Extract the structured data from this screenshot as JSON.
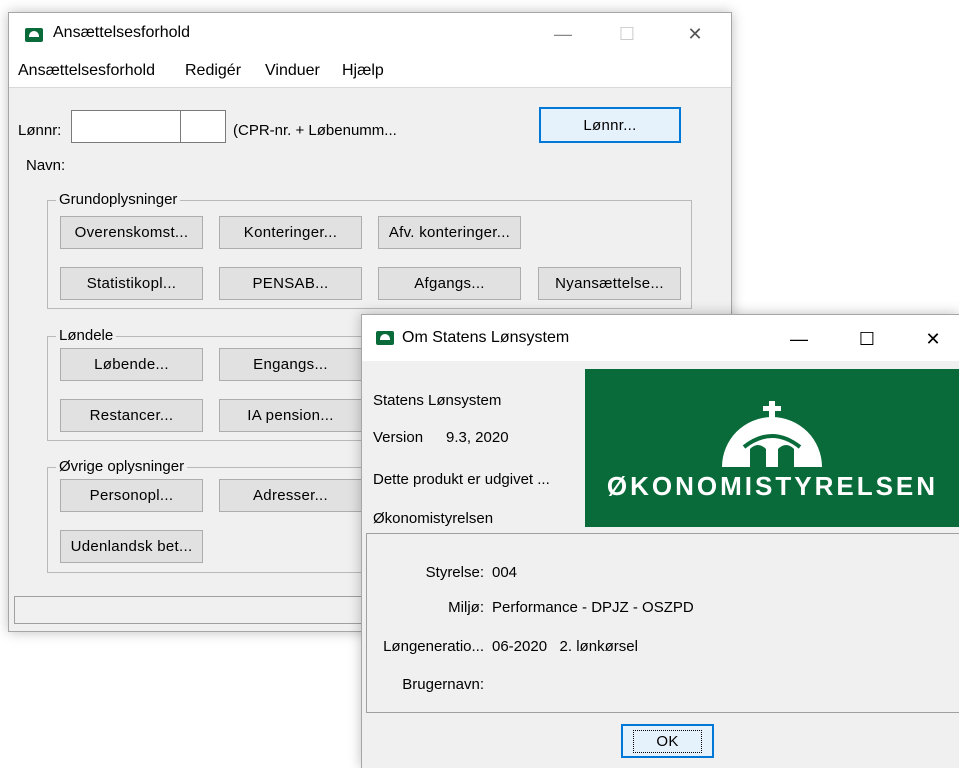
{
  "main_window": {
    "title": "Ansættelsesforhold",
    "menu": [
      "Ansættelsesforhold",
      "Redigér",
      "Vinduer",
      "Hjælp"
    ],
    "lonnr_label": "Lønnr:",
    "lonnr_hint": "(CPR-nr. + Løbenumm...",
    "lonnr_button": "Lønnr...",
    "navn_label": "Navn:",
    "groups": {
      "grundoplysninger": {
        "label": "Grundoplysninger",
        "buttons": [
          "Overenskomst...",
          "Konteringer...",
          "Afv. konteringer...",
          "Statistikopl...",
          "PENSAB...",
          "Afgangs...",
          "Nyansættelse..."
        ]
      },
      "londele": {
        "label": "Løndele",
        "buttons": [
          "Løbende...",
          "Engangs...",
          "Restancer...",
          "IA pension..."
        ]
      },
      "ovrige": {
        "label": "Øvrige oplysninger",
        "buttons": [
          "Personopl...",
          "Adresser...",
          "Udenlandsk bet..."
        ]
      }
    }
  },
  "about_dialog": {
    "title": "Om Statens Lønsystem",
    "product": "Statens Lønsystem",
    "version_label": "Version",
    "version_value": "9.3, 2020",
    "published": "Dette produkt er udgivet ...",
    "publisher": "Økonomistyrelsen",
    "logo_text": "ØKONOMISTYRELSEN",
    "fields": [
      {
        "label": "Styrelse:",
        "value": "004"
      },
      {
        "label": "Miljø:",
        "value": "Performance - DPJZ - OSZPD"
      },
      {
        "label": "Løngeneratio...",
        "value": "06-2020   2. lønkørsel"
      },
      {
        "label": "Brugernavn:",
        "value": ""
      }
    ],
    "ok_button": "OK"
  },
  "window_controls": {
    "minimize": "—",
    "maximize": "☐",
    "close": "✕"
  },
  "colors": {
    "brand_green": "#0a6b3a",
    "focus_blue": "#0078d7"
  }
}
